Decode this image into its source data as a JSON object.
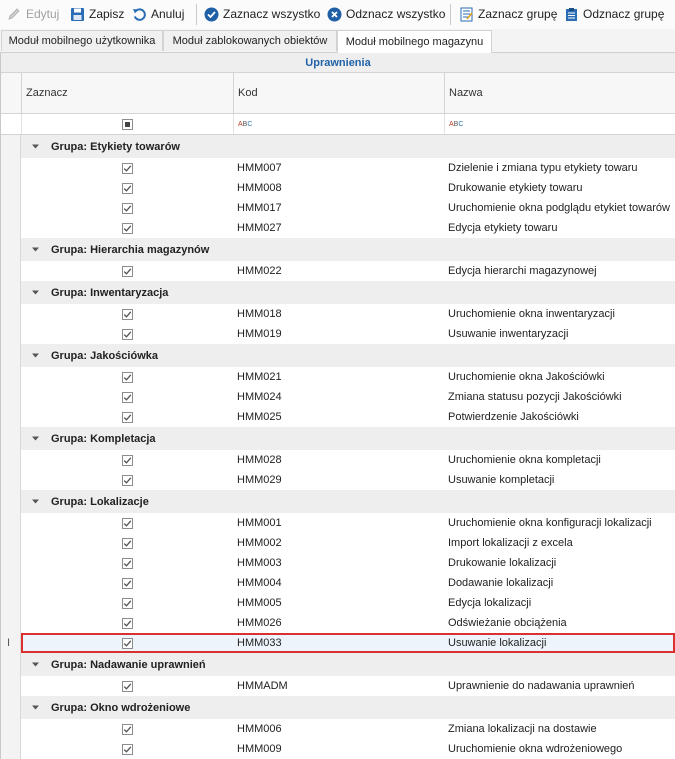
{
  "toolbar": {
    "edit_label": "Edytuj",
    "save_label": "Zapisz",
    "cancel_label": "Anuluj",
    "select_all_label": "Zaznacz wszystko",
    "deselect_all_label": "Odznacz wszystko",
    "select_group_label": "Zaznacz grupę",
    "deselect_group_label": "Odznacz grupę"
  },
  "tabs": [
    {
      "label": "Moduł mobilnego użytkownika",
      "active": false
    },
    {
      "label": "Moduł zablokowanych obiektów",
      "active": false
    },
    {
      "label": "Moduł mobilnego magazynu",
      "active": true
    }
  ],
  "grid": {
    "band_title": "Uprawnienia",
    "columns": [
      "Zaznacz",
      "Kod",
      "Nazwa"
    ],
    "filter_abc": "ABC"
  },
  "groups": [
    {
      "title": "Grupa: Etykiety towarów",
      "rows": [
        {
          "code": "HMM007",
          "name": "Dzielenie i zmiana typu etykiety towaru",
          "checked": true
        },
        {
          "code": "HMM008",
          "name": "Drukowanie etykiety towaru",
          "checked": true
        },
        {
          "code": "HMM017",
          "name": "Uruchomienie okna podglądu etykiet towarów",
          "checked": true
        },
        {
          "code": "HMM027",
          "name": "Edycja etykiety towaru",
          "checked": true
        }
      ]
    },
    {
      "title": "Grupa: Hierarchia magazynów",
      "rows": [
        {
          "code": "HMM022",
          "name": "Edycja hierarchi magazynowej",
          "checked": true
        }
      ]
    },
    {
      "title": "Grupa: Inwentaryzacja",
      "rows": [
        {
          "code": "HMM018",
          "name": "Uruchomienie okna inwentaryzacji",
          "checked": true
        },
        {
          "code": "HMM019",
          "name": "Usuwanie inwentaryzacji",
          "checked": true
        }
      ]
    },
    {
      "title": "Grupa: Jakościówka",
      "rows": [
        {
          "code": "HMM021",
          "name": "Uruchomienie okna Jakościówki",
          "checked": true
        },
        {
          "code": "HMM024",
          "name": "Zmiana statusu pozycji Jakościówki",
          "checked": true
        },
        {
          "code": "HMM025",
          "name": "Potwierdzenie Jakościówki",
          "checked": true
        }
      ]
    },
    {
      "title": "Grupa: Kompletacja",
      "rows": [
        {
          "code": "HMM028",
          "name": "Uruchomienie okna kompletacji",
          "checked": true
        },
        {
          "code": "HMM029",
          "name": "Usuwanie kompletacji",
          "checked": true
        }
      ]
    },
    {
      "title": "Grupa: Lokalizacje",
      "rows": [
        {
          "code": "HMM001",
          "name": "Uruchomienie okna konfiguracji lokalizacji",
          "checked": true
        },
        {
          "code": "HMM002",
          "name": "Import lokalizacji z excela",
          "checked": true
        },
        {
          "code": "HMM003",
          "name": "Drukowanie lokalizacji",
          "checked": true
        },
        {
          "code": "HMM004",
          "name": "Dodawanie lokalizacji",
          "checked": true
        },
        {
          "code": "HMM005",
          "name": "Edycja lokalizacji",
          "checked": true
        },
        {
          "code": "HMM026",
          "name": "Odświeżanie obciążenia",
          "checked": true
        },
        {
          "code": "HMM033",
          "name": "Usuwanie lokalizacji",
          "checked": true,
          "focused": true
        }
      ]
    },
    {
      "title": "Grupa: Nadawanie uprawnień",
      "rows": [
        {
          "code": "HMMADM",
          "name": "Uprawnienie do nadawania uprawnień",
          "checked": true
        }
      ]
    },
    {
      "title": "Grupa: Okno wdrożeniowe",
      "rows": [
        {
          "code": "HMM006",
          "name": "Zmiana lokalizacji na dostawie",
          "checked": true
        },
        {
          "code": "HMM009",
          "name": "Uruchomienie okna wdrożeniowego",
          "checked": true
        }
      ]
    }
  ],
  "colors": {
    "accent": "#1f62a8",
    "focus_border": "#d93030",
    "group_bg": "#eeeeee"
  }
}
